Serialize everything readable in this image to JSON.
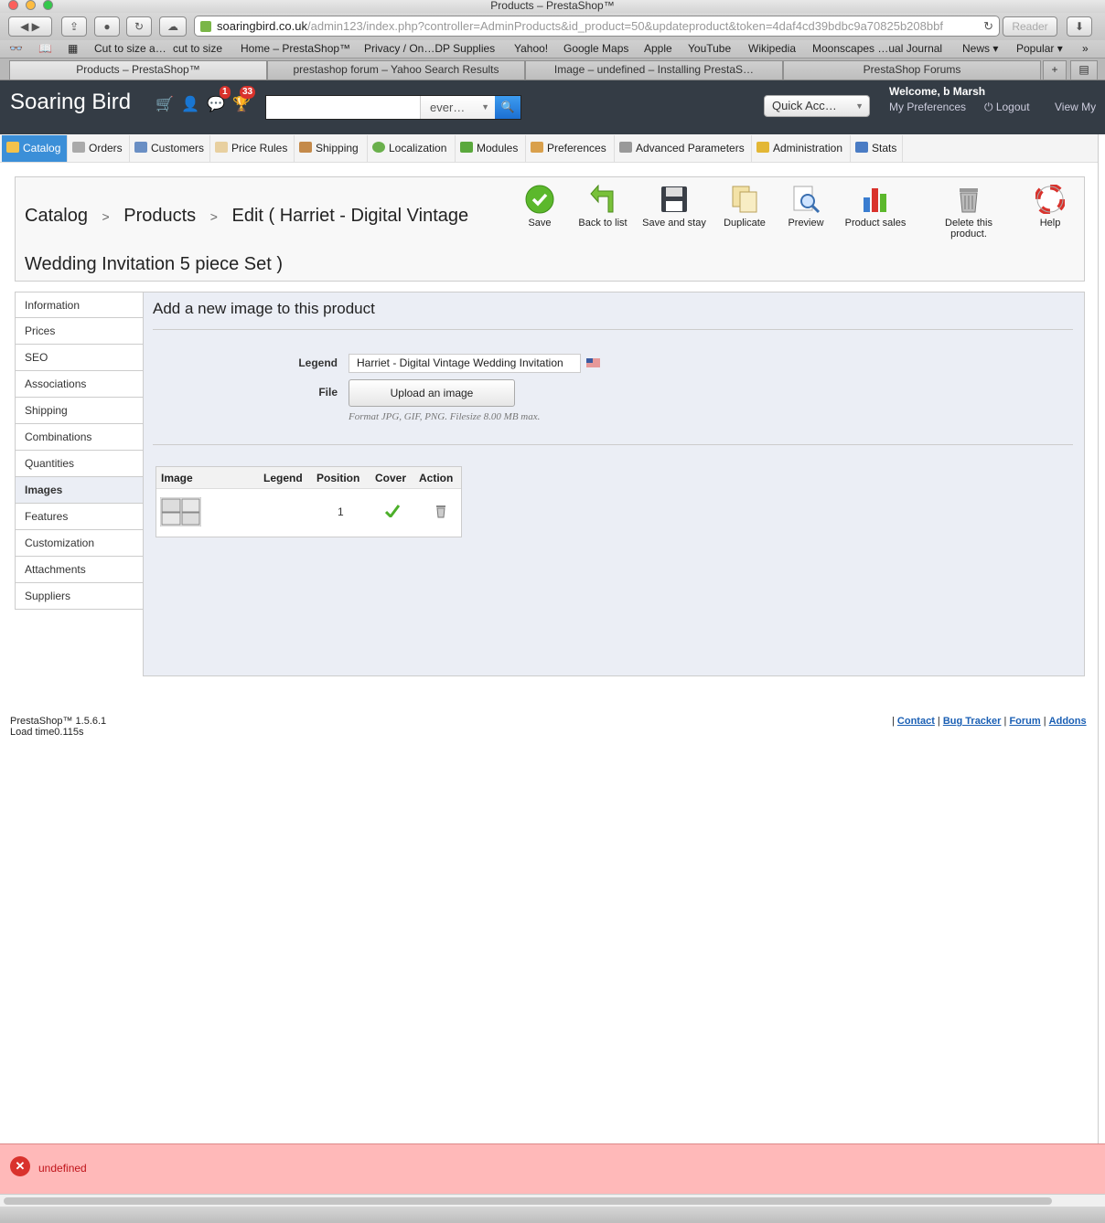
{
  "browser": {
    "window_title": "Products – PrestaShop™",
    "url_domain": "soaringbird.co.uk",
    "url_path": "/admin123/index.php?controller=AdminProducts&id_product=50&updateproduct&token=4daf4cd39bdbc9a70825b208bbf",
    "reader_label": "Reader",
    "bookmarks": [
      "Cut to size a…",
      "cut to size",
      "Home – PrestaShop™",
      "Privacy / On…DP Supplies",
      "Yahoo!",
      "Google Maps",
      "Apple",
      "YouTube",
      "Wikipedia",
      "Moonscapes …ual Journal",
      "News ▾",
      "Popular ▾"
    ],
    "tabs": [
      "Products – PrestaShop™",
      "prestashop forum – Yahoo Search Results",
      "Image – undefined – Installing PrestaS…",
      "PrestaShop Forums"
    ]
  },
  "header": {
    "logo": "Soaring Bird",
    "badge_messages": "1",
    "badge_notifications": "33",
    "search_scope": "ever…",
    "quick_access": "Quick Acc…",
    "welcome": "Welcome, b Marsh",
    "my_preferences": "My Preferences",
    "logout": "Logout",
    "view_my": "View My"
  },
  "nav": [
    "Catalog",
    "Orders",
    "Customers",
    "Price Rules",
    "Shipping",
    "Localization",
    "Modules",
    "Preferences",
    "Advanced Parameters",
    "Administration",
    "Stats"
  ],
  "page": {
    "breadcrumb_1": "Catalog",
    "breadcrumb_2": "Products",
    "breadcrumb_3": "Edit ( Harriet - Digital Vintage Wedding Invitation 5 piece Set )",
    "toolbar": [
      "Save",
      "Back to list",
      "Save and stay",
      "Duplicate",
      "Preview",
      "Product sales",
      "Delete this product.",
      "Help"
    ]
  },
  "sidetabs": [
    "Information",
    "Prices",
    "SEO",
    "Associations",
    "Shipping",
    "Combinations",
    "Quantities",
    "Images",
    "Features",
    "Customization",
    "Attachments",
    "Suppliers"
  ],
  "content": {
    "heading": "Add a new image to this product",
    "legend_label": "Legend",
    "legend_value": "Harriet  - Digital  Vintage Wedding Invitation",
    "file_label": "File",
    "upload_button": "Upload an image",
    "hint": "Format JPG, GIF, PNG. Filesize 8.00 MB max.",
    "table_headers": [
      "Image",
      "Legend",
      "Position",
      "Cover",
      "Action"
    ],
    "rows": [
      {
        "position": "1"
      }
    ]
  },
  "footer": {
    "version": "PrestaShop™ 1.5.6.1",
    "load_time": "Load time0.115s",
    "links": [
      "Contact",
      "Bug Tracker",
      "Forum",
      "Addons"
    ]
  },
  "error": {
    "message": "undefined"
  },
  "colors": {
    "accent": "#3b8fd8",
    "header_bg": "#343c45",
    "error_bg": "#ffb9b9"
  }
}
